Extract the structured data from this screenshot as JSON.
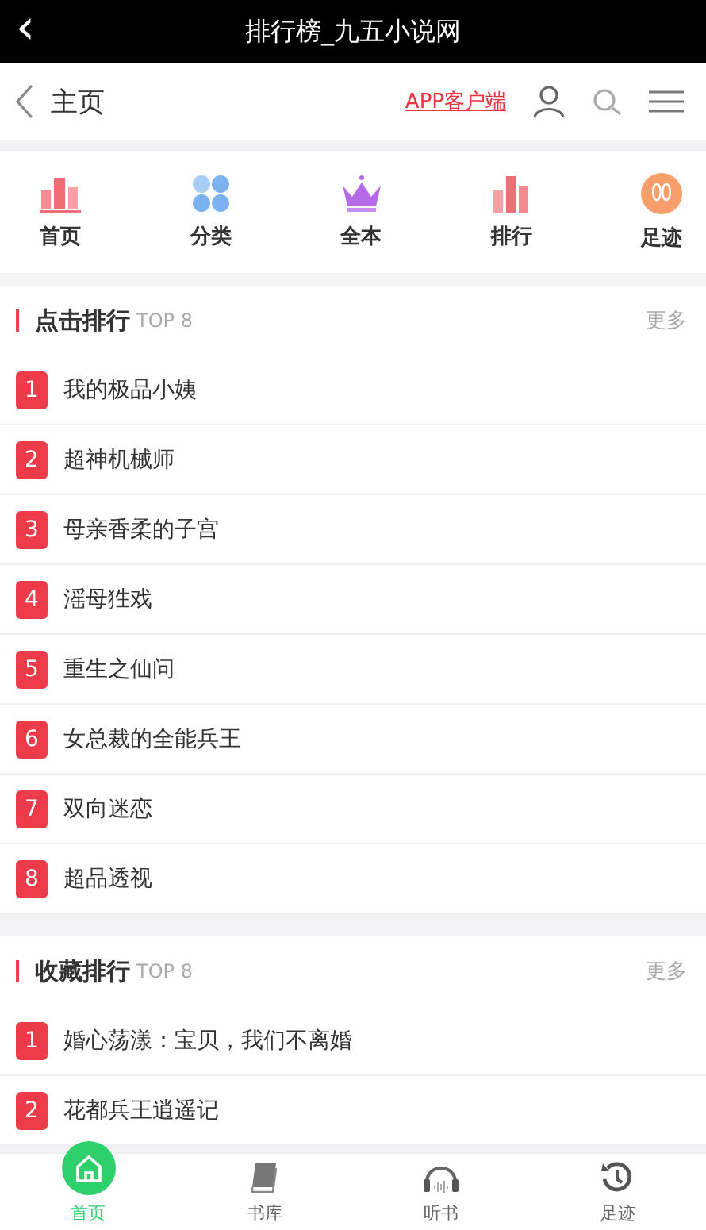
{
  "window": {
    "title": "排行榜_九五小说网",
    "back_icon": "‹"
  },
  "header": {
    "title": "主页",
    "app_link": "APP客户端"
  },
  "nav": [
    {
      "label": "首页",
      "kind": "bars"
    },
    {
      "label": "分类",
      "kind": "dots"
    },
    {
      "label": "全本",
      "kind": "crown"
    },
    {
      "label": "排行",
      "kind": "rank"
    },
    {
      "label": "足迹",
      "kind": "foot"
    }
  ],
  "sections": [
    {
      "title": "点击排行",
      "tag": "TOP 8",
      "more": "更多",
      "items": [
        {
          "rank": "1",
          "title": "我的极品小姨"
        },
        {
          "rank": "2",
          "title": "超神机械师"
        },
        {
          "rank": "3",
          "title": "母亲香柔的子宫"
        },
        {
          "rank": "4",
          "title": "滛母狌戏"
        },
        {
          "rank": "5",
          "title": "重生之仙问"
        },
        {
          "rank": "6",
          "title": "女总裁的全能兵王"
        },
        {
          "rank": "7",
          "title": "双向迷恋"
        },
        {
          "rank": "8",
          "title": "超品透视"
        }
      ]
    },
    {
      "title": "收藏排行",
      "tag": "TOP 8",
      "more": "更多",
      "items": [
        {
          "rank": "1",
          "title": "婚心荡漾：宝贝，我们不离婚"
        },
        {
          "rank": "2",
          "title": "花都兵王逍遥记"
        }
      ]
    }
  ],
  "tabbar": [
    {
      "label": "首页",
      "kind": "home",
      "selected": true
    },
    {
      "label": "书库",
      "kind": "book",
      "selected": false
    },
    {
      "label": "听书",
      "kind": "headphones",
      "selected": false
    },
    {
      "label": "足迹",
      "kind": "history",
      "selected": false
    }
  ]
}
